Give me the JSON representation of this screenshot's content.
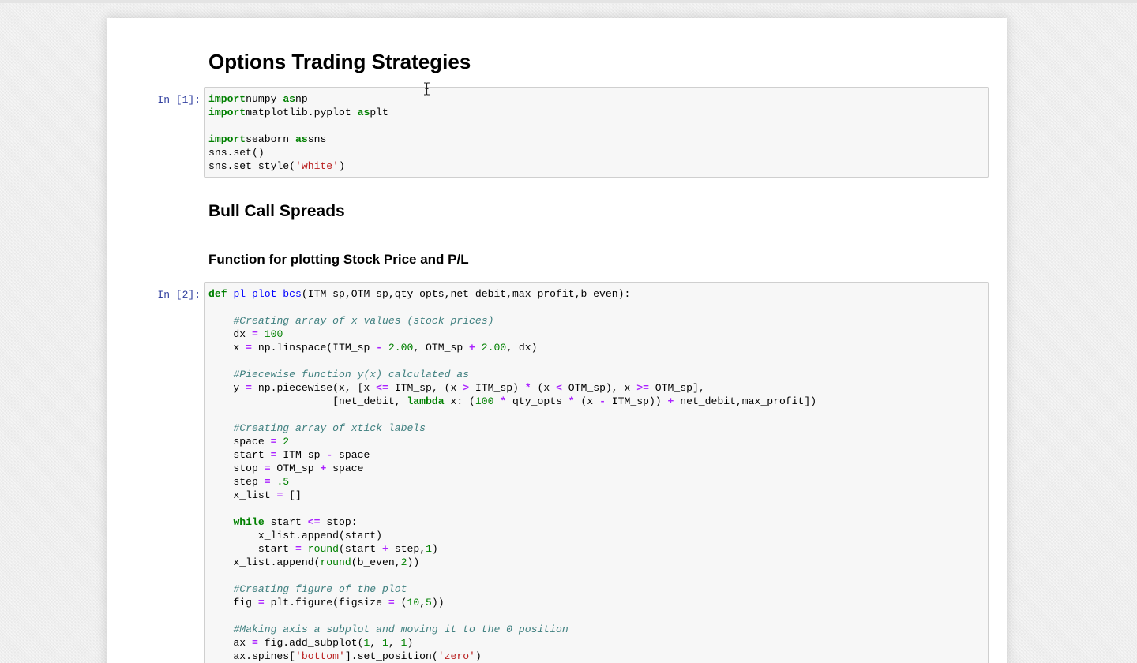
{
  "notebook": {
    "title": "Options Trading Strategies",
    "heading_bull_call": "Bull Call Spreads",
    "heading_function": "Function for plotting Stock Price and P/L"
  },
  "cells": [
    {
      "prompt": "In [1]:",
      "lines": [
        [
          [
            "kw",
            "import"
          ],
          [
            "",
            "numpy "
          ],
          [
            "kw",
            "as"
          ],
          [
            "",
            "np"
          ]
        ],
        [
          [
            "kw",
            "import"
          ],
          [
            "",
            "matplotlib.pyplot "
          ],
          [
            "kw",
            "as"
          ],
          [
            "",
            "plt"
          ]
        ],
        [],
        [
          [
            "kw",
            "import"
          ],
          [
            "",
            "seaborn "
          ],
          [
            "kw",
            "as"
          ],
          [
            "",
            "sns"
          ]
        ],
        [
          [
            "",
            "sns.set()"
          ]
        ],
        [
          [
            "",
            "sns.set_style("
          ],
          [
            "str",
            "'white'"
          ],
          [
            "",
            ")"
          ]
        ]
      ]
    },
    {
      "prompt": "In [2]:",
      "lines": [
        [
          [
            "kw",
            "def"
          ],
          [
            "",
            " "
          ],
          [
            "fn",
            "pl_plot_bcs"
          ],
          [
            "",
            "(ITM_sp,OTM_sp,qty_opts,net_debit,max_profit,b_even):"
          ]
        ],
        [],
        [
          [
            "",
            "    "
          ],
          [
            "cm",
            "#Creating array of x values (stock prices)"
          ]
        ],
        [
          [
            "",
            "    dx "
          ],
          [
            "op",
            "="
          ],
          [
            "",
            " "
          ],
          [
            "num",
            "100"
          ]
        ],
        [
          [
            "",
            "    x "
          ],
          [
            "op",
            "="
          ],
          [
            "",
            " np.linspace(ITM_sp "
          ],
          [
            "op",
            "-"
          ],
          [
            "",
            " "
          ],
          [
            "num",
            "2.00"
          ],
          [
            "",
            ", OTM_sp "
          ],
          [
            "op",
            "+"
          ],
          [
            "",
            " "
          ],
          [
            "num",
            "2.00"
          ],
          [
            "",
            ", dx)"
          ]
        ],
        [],
        [
          [
            "",
            "    "
          ],
          [
            "cm",
            "#Piecewise function y(x) calculated as"
          ]
        ],
        [
          [
            "",
            "    y "
          ],
          [
            "op",
            "="
          ],
          [
            "",
            " np.piecewise(x, [x "
          ],
          [
            "op",
            "<="
          ],
          [
            "",
            " ITM_sp, (x "
          ],
          [
            "op",
            ">"
          ],
          [
            "",
            " ITM_sp) "
          ],
          [
            "op",
            "*"
          ],
          [
            "",
            " (x "
          ],
          [
            "op",
            "<"
          ],
          [
            "",
            " OTM_sp), x "
          ],
          [
            "op",
            ">="
          ],
          [
            "",
            " OTM_sp],"
          ]
        ],
        [
          [
            "",
            "                    [net_debit, "
          ],
          [
            "kw",
            "lambda"
          ],
          [
            "",
            " x: ("
          ],
          [
            "num",
            "100"
          ],
          [
            "",
            " "
          ],
          [
            "op",
            "*"
          ],
          [
            "",
            " qty_opts "
          ],
          [
            "op",
            "*"
          ],
          [
            "",
            " (x "
          ],
          [
            "op",
            "-"
          ],
          [
            "",
            " ITM_sp)) "
          ],
          [
            "op",
            "+"
          ],
          [
            "",
            " net_debit,max_profit])"
          ]
        ],
        [],
        [
          [
            "",
            "    "
          ],
          [
            "cm",
            "#Creating array of xtick labels"
          ]
        ],
        [
          [
            "",
            "    space "
          ],
          [
            "op",
            "="
          ],
          [
            "",
            " "
          ],
          [
            "num",
            "2"
          ]
        ],
        [
          [
            "",
            "    start "
          ],
          [
            "op",
            "="
          ],
          [
            "",
            " ITM_sp "
          ],
          [
            "op",
            "-"
          ],
          [
            "",
            " space"
          ]
        ],
        [
          [
            "",
            "    stop "
          ],
          [
            "op",
            "="
          ],
          [
            "",
            " OTM_sp "
          ],
          [
            "op",
            "+"
          ],
          [
            "",
            " space"
          ]
        ],
        [
          [
            "",
            "    step "
          ],
          [
            "op",
            "="
          ],
          [
            "",
            " "
          ],
          [
            "num",
            ".5"
          ]
        ],
        [
          [
            "",
            "    x_list "
          ],
          [
            "op",
            "="
          ],
          [
            "",
            " []"
          ]
        ],
        [],
        [
          [
            "",
            "    "
          ],
          [
            "kw",
            "while"
          ],
          [
            "",
            " start "
          ],
          [
            "op",
            "<="
          ],
          [
            "",
            " stop:"
          ]
        ],
        [
          [
            "",
            "        x_list.append(start)"
          ]
        ],
        [
          [
            "",
            "        start "
          ],
          [
            "op",
            "="
          ],
          [
            "",
            " "
          ],
          [
            "bi",
            "round"
          ],
          [
            "",
            "(start "
          ],
          [
            "op",
            "+"
          ],
          [
            "",
            " step,"
          ],
          [
            "num",
            "1"
          ],
          [
            "",
            ")"
          ]
        ],
        [
          [
            "",
            "    x_list.append("
          ],
          [
            "bi",
            "round"
          ],
          [
            "",
            "(b_even,"
          ],
          [
            "num",
            "2"
          ],
          [
            "",
            "))"
          ]
        ],
        [],
        [
          [
            "",
            "    "
          ],
          [
            "cm",
            "#Creating figure of the plot"
          ]
        ],
        [
          [
            "",
            "    fig "
          ],
          [
            "op",
            "="
          ],
          [
            "",
            " plt.figure(figsize "
          ],
          [
            "op",
            "="
          ],
          [
            "",
            " ("
          ],
          [
            "num",
            "10"
          ],
          [
            "",
            ","
          ],
          [
            "num",
            "5"
          ],
          [
            "",
            "))"
          ]
        ],
        [],
        [
          [
            "",
            "    "
          ],
          [
            "cm",
            "#Making axis a subplot and moving it to the 0 position"
          ]
        ],
        [
          [
            "",
            "    ax "
          ],
          [
            "op",
            "="
          ],
          [
            "",
            " fig.add_subplot("
          ],
          [
            "num",
            "1"
          ],
          [
            "",
            ", "
          ],
          [
            "num",
            "1"
          ],
          [
            "",
            ", "
          ],
          [
            "num",
            "1"
          ],
          [
            "",
            ")"
          ]
        ],
        [
          [
            "",
            "    ax.spines["
          ],
          [
            "str",
            "'bottom'"
          ],
          [
            "",
            "].set_position("
          ],
          [
            "str",
            "'zero'"
          ],
          [
            "",
            ")"
          ]
        ]
      ]
    }
  ],
  "icons": {
    "text_cursor": "i-beam-cursor-icon"
  }
}
